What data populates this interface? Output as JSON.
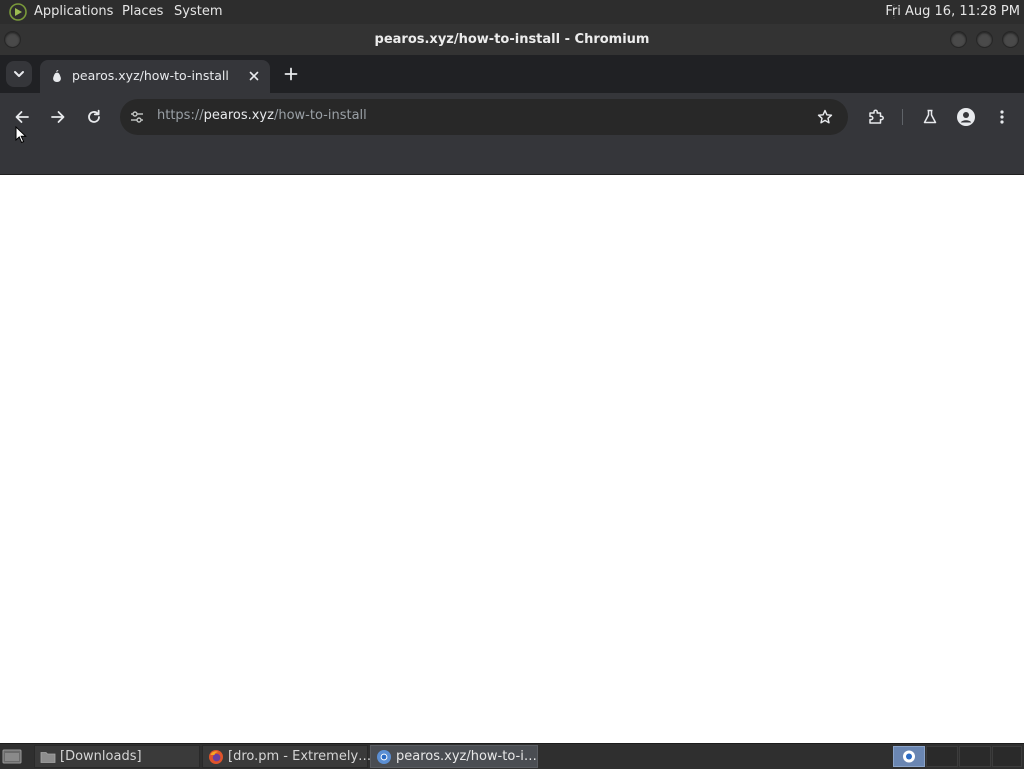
{
  "top_panel": {
    "menus": [
      "Applications",
      "Places",
      "System"
    ],
    "clock": "Fri Aug 16, 11:28 PM"
  },
  "window": {
    "title": "pearos.xyz/how-to-install - Chromium"
  },
  "browser": {
    "tab": {
      "title": "pearos.xyz/how-to-install"
    },
    "omnibox": {
      "scheme": "https://",
      "host": "pearos.xyz",
      "path": "/how-to-install"
    }
  },
  "taskbar": {
    "tasks": [
      {
        "label": "[Downloads]",
        "icon": "folder-icon",
        "active": false
      },
      {
        "label": "[dro.pm - Extremely…",
        "icon": "firefox-icon",
        "active": false
      },
      {
        "label": "pearos.xyz/how-to-i…",
        "icon": "chromium-icon",
        "active": true
      }
    ]
  },
  "colors": {
    "panel": "#2d2d2d",
    "tabstrip": "#202124",
    "toolbar": "#35363a",
    "omnibox": "#282828",
    "page": "#ffffff",
    "workspace_active": "#6a86b2"
  }
}
